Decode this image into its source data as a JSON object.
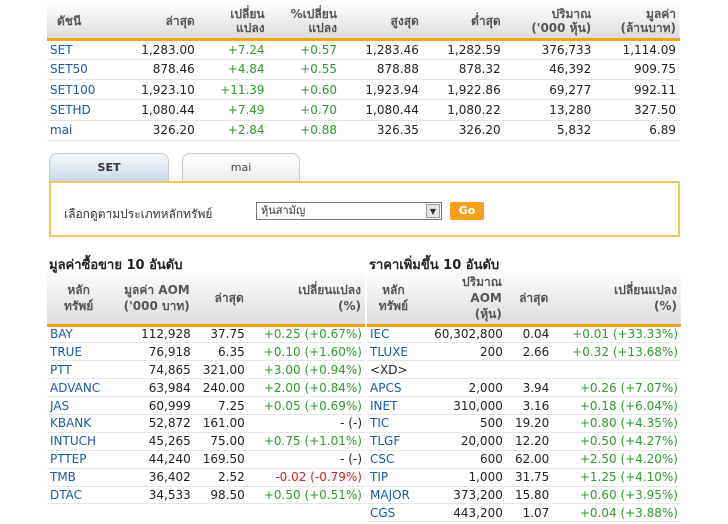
{
  "index_table": {
    "headers": [
      "ดัชนี",
      "ล่าสุด",
      "เปลี่ยน\nแปลง",
      "%เปลี่ยน\nแปลง",
      "สูงสุด",
      "ต่ำสุด",
      "ปริมาณ\n('000 หุ้น)",
      "มูลค่า\n(ล้านบาท)"
    ],
    "rows": [
      {
        "name": "SET",
        "last": "1,283.00",
        "change": "+7.24",
        "pct": "+0.57",
        "high": "1,283.46",
        "low": "1,282.59",
        "volume": "376,733",
        "value": "1,114.09"
      },
      {
        "name": "SET50",
        "last": "878.46",
        "change": "+4.84",
        "pct": "+0.55",
        "high": "878.88",
        "low": "878.32",
        "volume": "46,392",
        "value": "909.75"
      },
      {
        "name": "SET100",
        "last": "1,923.10",
        "change": "+11.39",
        "pct": "+0.60",
        "high": "1,923.94",
        "low": "1,922.86",
        "volume": "69,277",
        "value": "992.11"
      },
      {
        "name": "SETHD",
        "last": "1,080.44",
        "change": "+7.49",
        "pct": "+0.70",
        "high": "1,080.44",
        "low": "1,080.22",
        "volume": "13,280",
        "value": "327.50"
      },
      {
        "name": "mai",
        "last": "326.20",
        "change": "+2.84",
        "pct": "+0.88",
        "high": "326.35",
        "low": "326.20",
        "volume": "5,832",
        "value": "6.89"
      }
    ]
  },
  "tabs": {
    "set": "SET",
    "mai": "mai"
  },
  "filter": {
    "label": "เลือกดูตามประเภทหลักทรัพย์",
    "selected": "หุ้นสามัญ",
    "go": "Go"
  },
  "left_section": {
    "title": "มูลค่าซื้อขาย 10 อันดับ",
    "headers": [
      "หลัก\nทรัพย์",
      "มูลค่า AOM\n('000 บาท)",
      "ล่าสุด",
      "เปลี่ยนแปลง\n(%)"
    ],
    "rows": [
      {
        "symbol": "BAY",
        "value": "112,928",
        "last": "37.75",
        "change": "+0.25 (+0.67%)"
      },
      {
        "symbol": "TRUE",
        "value": "76,918",
        "last": "6.35",
        "change": "+0.10 (+1.60%)"
      },
      {
        "symbol": "PTT",
        "value": "74,865",
        "last": "321.00",
        "change": "+3.00 (+0.94%)"
      },
      {
        "symbol": "ADVANC",
        "value": "63,984",
        "last": "240.00",
        "change": "+2.00 (+0.84%)"
      },
      {
        "symbol": "JAS",
        "value": "60,999",
        "last": "7.25",
        "change": "+0.05 (+0.69%)"
      },
      {
        "symbol": "KBANK",
        "value": "52,872",
        "last": "161.00",
        "change": "- (-)"
      },
      {
        "symbol": "INTUCH",
        "value": "45,265",
        "last": "75.00",
        "change": "+0.75 (+1.01%)"
      },
      {
        "symbol": "PTTEP",
        "value": "44,240",
        "last": "169.50",
        "change": "- (-)"
      },
      {
        "symbol": "TMB",
        "value": "36,402",
        "last": "2.52",
        "change": "-0.02 (-0.79%)"
      },
      {
        "symbol": "DTAC",
        "value": "34,533",
        "last": "98.50",
        "change": "+0.50 (+0.51%)"
      }
    ]
  },
  "right_section": {
    "title": "ราคาเพิ่มขึ้น 10 อันดับ",
    "headers": [
      "หลัก\nทรัพย์",
      "ปริมาณ\nAOM\n(หุ้น)",
      "ล่าสุด",
      "เปลี่ยนแปลง\n(%)"
    ],
    "rows": [
      {
        "symbol": "IEC",
        "volume": "60,302,800",
        "last": "0.04",
        "change": "+0.01 (+33.33%)"
      },
      {
        "symbol": "TLUXE",
        "volume": "200",
        "last": "2.66",
        "change": "+0.32 (+13.68%)"
      },
      {
        "symbol": "<XD>",
        "volume": "",
        "last": "",
        "change": ""
      },
      {
        "symbol": "APCS",
        "volume": "2,000",
        "last": "3.94",
        "change": "+0.26 (+7.07%)"
      },
      {
        "symbol": "INET",
        "volume": "310,000",
        "last": "3.16",
        "change": "+0.18 (+6.04%)"
      },
      {
        "symbol": "TIC",
        "volume": "500",
        "last": "19.20",
        "change": "+0.80 (+4.35%)"
      },
      {
        "symbol": "TLGF",
        "volume": "20,000",
        "last": "12.20",
        "change": "+0.50 (+4.27%)"
      },
      {
        "symbol": "CSC",
        "volume": "600",
        "last": "62.00",
        "change": "+2.50 (+4.20%)"
      },
      {
        "symbol": "TIP",
        "volume": "1,000",
        "last": "31.75",
        "change": "+1.25 (+4.10%)"
      },
      {
        "symbol": "MAJOR",
        "volume": "373,200",
        "last": "15.80",
        "change": "+0.60 (+3.95%)"
      },
      {
        "symbol": "CGS",
        "volume": "443,200",
        "last": "1.07",
        "change": "+0.04 (+3.88%)"
      }
    ]
  },
  "colors": {
    "accent": "#f3a21c",
    "positive": "#2e9b2e",
    "negative": "#d42020",
    "symbol": "#1a5aa8"
  }
}
